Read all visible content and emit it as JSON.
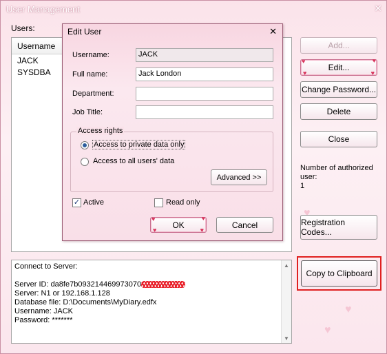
{
  "window": {
    "title": "User Management",
    "close_glyph": "✕"
  },
  "users": {
    "label": "Users:",
    "column_header": "Username",
    "rows": [
      "JACK",
      "SYSDBA"
    ]
  },
  "side_buttons": {
    "add": "Add...",
    "edit": "Edit...",
    "change_password": "Change Password...",
    "delete": "Delete",
    "close": "Close",
    "registration_codes": "Registration Codes...",
    "copy_to_clipboard": "Copy to Clipboard"
  },
  "authorized": {
    "label_line1": "Number of authorized",
    "label_line2": "user:",
    "count": "1"
  },
  "connection_info": {
    "lines": [
      "Connect to Server:",
      "",
      "Server ID: da8fe7b093214469973070",
      "Server: N1 or 192.168.1.128",
      "Database file: D:\\Documents\\MyDiary.edfx",
      "Username: JACK",
      "Password: *******"
    ]
  },
  "edit_dialog": {
    "title": "Edit User",
    "close_glyph": "✕",
    "username_label": "Username:",
    "username_value": "JACK",
    "fullname_label": "Full name:",
    "fullname_value": "Jack London",
    "department_label": "Department:",
    "department_value": "",
    "jobtitle_label": "Job Title:",
    "jobtitle_value": "",
    "access_group_label": "Access rights",
    "access_private_label": "Access to private data only",
    "access_all_label": "Access to all users' data",
    "access_selected": "private",
    "advanced_button": "Advanced >>",
    "active_label": "Active",
    "active_checked": true,
    "readonly_label": "Read only",
    "readonly_checked": false,
    "ok_button": "OK",
    "cancel_button": "Cancel"
  },
  "colors": {
    "highlight_border": "#e02020",
    "theme_pink": "#fbe3ea",
    "heart": "#d8325a"
  }
}
